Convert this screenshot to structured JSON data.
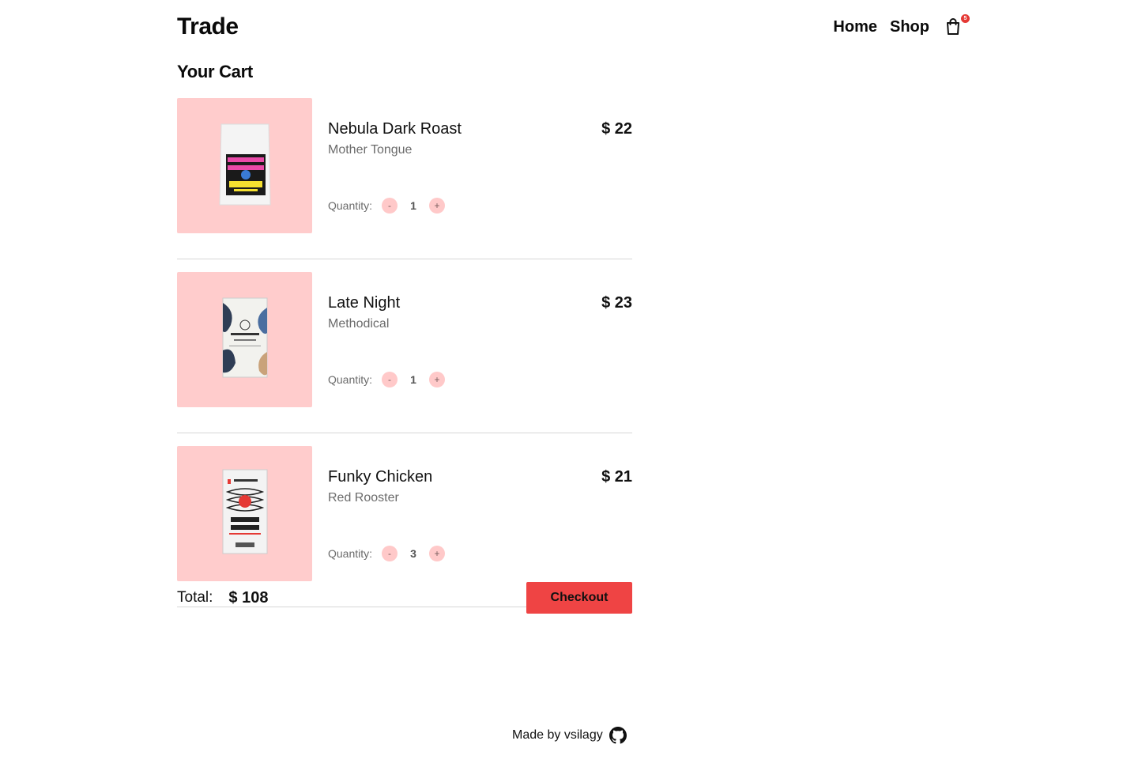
{
  "header": {
    "brand": "Trade",
    "nav": {
      "home": "Home",
      "shop": "Shop"
    },
    "cart_badge": "5",
    "cart_icon": "shopping-bag-icon"
  },
  "cart": {
    "title": "Your Cart",
    "quantity_label": "Quantity:",
    "decrement_label": "-",
    "increment_label": "+",
    "items": [
      {
        "name": "Nebula Dark Roast",
        "brand": "Mother Tongue",
        "price": "$ 22",
        "quantity": "1",
        "image_icon": "coffee-bag-nebula"
      },
      {
        "name": "Late Night",
        "brand": "Methodical",
        "price": "$ 23",
        "quantity": "1",
        "image_icon": "coffee-bag-late-night"
      },
      {
        "name": "Funky Chicken",
        "brand": "Red Rooster",
        "price": "$ 21",
        "quantity": "3",
        "image_icon": "coffee-bag-funky-chicken"
      }
    ],
    "total_label": "Total:",
    "total_value": "$ 108",
    "checkout_label": "Checkout"
  },
  "footer": {
    "text": "Made by vsilagy",
    "icon": "github-icon"
  },
  "colors": {
    "accent": "#ef4444",
    "thumb_bg": "#ffcccc",
    "qty_btn_bg": "#ffc9c9",
    "badge": "#e53935",
    "muted_text": "#6b6b6b"
  }
}
